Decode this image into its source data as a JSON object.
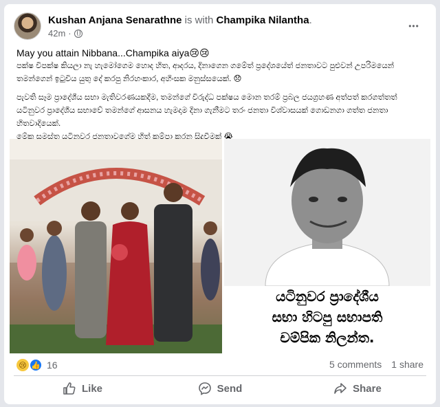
{
  "post": {
    "author": "Kushan Anjana Senarathne",
    "with_text": "is with",
    "tagged": "Champika Nilantha",
    "tagged_suffix": ".",
    "time": "42m",
    "separator": "·",
    "visibility_icon": "globe-icon",
    "more_label": "•••"
  },
  "body": {
    "line1": "May you attain Nibbana...Champika aiya😢😢",
    "line2": "පක්ෂ විපක්ෂ කියලා නැ හැමෝගෙම හොද හිත, ආදරය, දිනාගෙන ගමේත් ප්‍රදේශයේත් ජනතාවට පුළුවන් උපරිමයෙන් තමන්ගෙන් ඉටුවිය යුතු දේ කරපු නිරහංකාර, අහිංසක මනුස්සයෙක්. 😞",
    "line3": "පැවති සෑම ප්‍රාදේශීය සභා මැතිවරණයකදීම, තමන්ගේ විරුද්ධ පක්ෂය මොන තරම් ප්‍රබල ජයග්‍රහණ අත්පත් කරගත්තත් යටිනුවර ප්‍රාදේශීය සභාවේ තමන්ගේ ආසනය හැමදාම දිනා ගැනීමට තරං ජනතා විශ්වාසයක් ගොඩනගා ගත්ත ජනතා හිතවාදියෙක්.",
    "line4": "මේක සමස්ත යටිනුවර ජනතාවගේම හිත් කම්පා කරන සිදුවීමක් 😭"
  },
  "image_caption": {
    "line1": "යටිනුවර ප්‍රාදේශීය",
    "line2": "සභා හිටපු සභාපති",
    "line3": "චම්පික නිලන්ත."
  },
  "reactions": {
    "icons": [
      "sad-reaction-icon",
      "like-reaction-icon"
    ],
    "sad_glyph": "😢",
    "like_glyph": "👍",
    "count": "16"
  },
  "stats": {
    "comments": "5 comments",
    "shares": "1 share"
  },
  "actions": {
    "like": "Like",
    "send": "Send",
    "share": "Share"
  },
  "colors": {
    "background": "#e4e6eb",
    "card": "#ffffff",
    "secondary_text": "#65676b",
    "like_blue": "#1877f2"
  }
}
